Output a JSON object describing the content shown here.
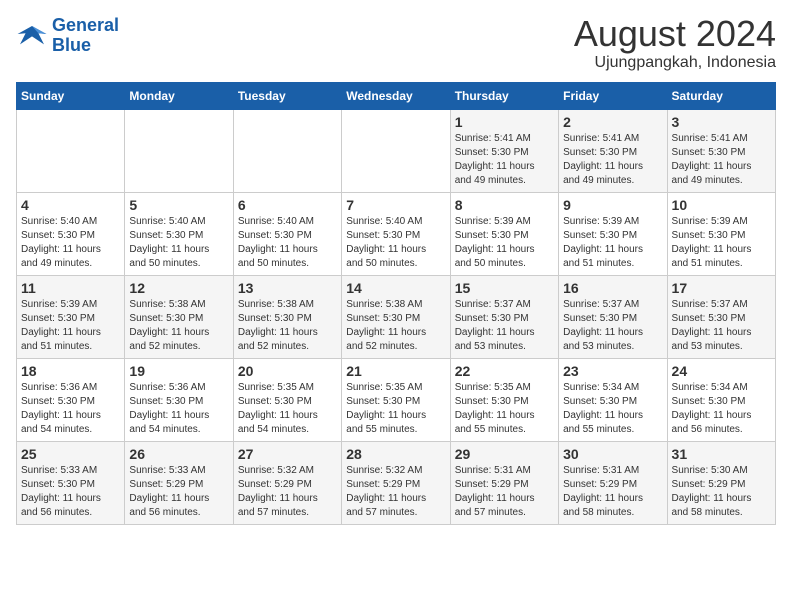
{
  "logo": {
    "line1": "General",
    "line2": "Blue"
  },
  "title": "August 2024",
  "subtitle": "Ujungpangkah, Indonesia",
  "headers": [
    "Sunday",
    "Monday",
    "Tuesday",
    "Wednesday",
    "Thursday",
    "Friday",
    "Saturday"
  ],
  "weeks": [
    [
      {
        "day": "",
        "info": ""
      },
      {
        "day": "",
        "info": ""
      },
      {
        "day": "",
        "info": ""
      },
      {
        "day": "",
        "info": ""
      },
      {
        "day": "1",
        "info": "Sunrise: 5:41 AM\nSunset: 5:30 PM\nDaylight: 11 hours\nand 49 minutes."
      },
      {
        "day": "2",
        "info": "Sunrise: 5:41 AM\nSunset: 5:30 PM\nDaylight: 11 hours\nand 49 minutes."
      },
      {
        "day": "3",
        "info": "Sunrise: 5:41 AM\nSunset: 5:30 PM\nDaylight: 11 hours\nand 49 minutes."
      }
    ],
    [
      {
        "day": "4",
        "info": "Sunrise: 5:40 AM\nSunset: 5:30 PM\nDaylight: 11 hours\nand 49 minutes."
      },
      {
        "day": "5",
        "info": "Sunrise: 5:40 AM\nSunset: 5:30 PM\nDaylight: 11 hours\nand 50 minutes."
      },
      {
        "day": "6",
        "info": "Sunrise: 5:40 AM\nSunset: 5:30 PM\nDaylight: 11 hours\nand 50 minutes."
      },
      {
        "day": "7",
        "info": "Sunrise: 5:40 AM\nSunset: 5:30 PM\nDaylight: 11 hours\nand 50 minutes."
      },
      {
        "day": "8",
        "info": "Sunrise: 5:39 AM\nSunset: 5:30 PM\nDaylight: 11 hours\nand 50 minutes."
      },
      {
        "day": "9",
        "info": "Sunrise: 5:39 AM\nSunset: 5:30 PM\nDaylight: 11 hours\nand 51 minutes."
      },
      {
        "day": "10",
        "info": "Sunrise: 5:39 AM\nSunset: 5:30 PM\nDaylight: 11 hours\nand 51 minutes."
      }
    ],
    [
      {
        "day": "11",
        "info": "Sunrise: 5:39 AM\nSunset: 5:30 PM\nDaylight: 11 hours\nand 51 minutes."
      },
      {
        "day": "12",
        "info": "Sunrise: 5:38 AM\nSunset: 5:30 PM\nDaylight: 11 hours\nand 52 minutes."
      },
      {
        "day": "13",
        "info": "Sunrise: 5:38 AM\nSunset: 5:30 PM\nDaylight: 11 hours\nand 52 minutes."
      },
      {
        "day": "14",
        "info": "Sunrise: 5:38 AM\nSunset: 5:30 PM\nDaylight: 11 hours\nand 52 minutes."
      },
      {
        "day": "15",
        "info": "Sunrise: 5:37 AM\nSunset: 5:30 PM\nDaylight: 11 hours\nand 53 minutes."
      },
      {
        "day": "16",
        "info": "Sunrise: 5:37 AM\nSunset: 5:30 PM\nDaylight: 11 hours\nand 53 minutes."
      },
      {
        "day": "17",
        "info": "Sunrise: 5:37 AM\nSunset: 5:30 PM\nDaylight: 11 hours\nand 53 minutes."
      }
    ],
    [
      {
        "day": "18",
        "info": "Sunrise: 5:36 AM\nSunset: 5:30 PM\nDaylight: 11 hours\nand 54 minutes."
      },
      {
        "day": "19",
        "info": "Sunrise: 5:36 AM\nSunset: 5:30 PM\nDaylight: 11 hours\nand 54 minutes."
      },
      {
        "day": "20",
        "info": "Sunrise: 5:35 AM\nSunset: 5:30 PM\nDaylight: 11 hours\nand 54 minutes."
      },
      {
        "day": "21",
        "info": "Sunrise: 5:35 AM\nSunset: 5:30 PM\nDaylight: 11 hours\nand 55 minutes."
      },
      {
        "day": "22",
        "info": "Sunrise: 5:35 AM\nSunset: 5:30 PM\nDaylight: 11 hours\nand 55 minutes."
      },
      {
        "day": "23",
        "info": "Sunrise: 5:34 AM\nSunset: 5:30 PM\nDaylight: 11 hours\nand 55 minutes."
      },
      {
        "day": "24",
        "info": "Sunrise: 5:34 AM\nSunset: 5:30 PM\nDaylight: 11 hours\nand 56 minutes."
      }
    ],
    [
      {
        "day": "25",
        "info": "Sunrise: 5:33 AM\nSunset: 5:30 PM\nDaylight: 11 hours\nand 56 minutes."
      },
      {
        "day": "26",
        "info": "Sunrise: 5:33 AM\nSunset: 5:29 PM\nDaylight: 11 hours\nand 56 minutes."
      },
      {
        "day": "27",
        "info": "Sunrise: 5:32 AM\nSunset: 5:29 PM\nDaylight: 11 hours\nand 57 minutes."
      },
      {
        "day": "28",
        "info": "Sunrise: 5:32 AM\nSunset: 5:29 PM\nDaylight: 11 hours\nand 57 minutes."
      },
      {
        "day": "29",
        "info": "Sunrise: 5:31 AM\nSunset: 5:29 PM\nDaylight: 11 hours\nand 57 minutes."
      },
      {
        "day": "30",
        "info": "Sunrise: 5:31 AM\nSunset: 5:29 PM\nDaylight: 11 hours\nand 58 minutes."
      },
      {
        "day": "31",
        "info": "Sunrise: 5:30 AM\nSunset: 5:29 PM\nDaylight: 11 hours\nand 58 minutes."
      }
    ]
  ]
}
